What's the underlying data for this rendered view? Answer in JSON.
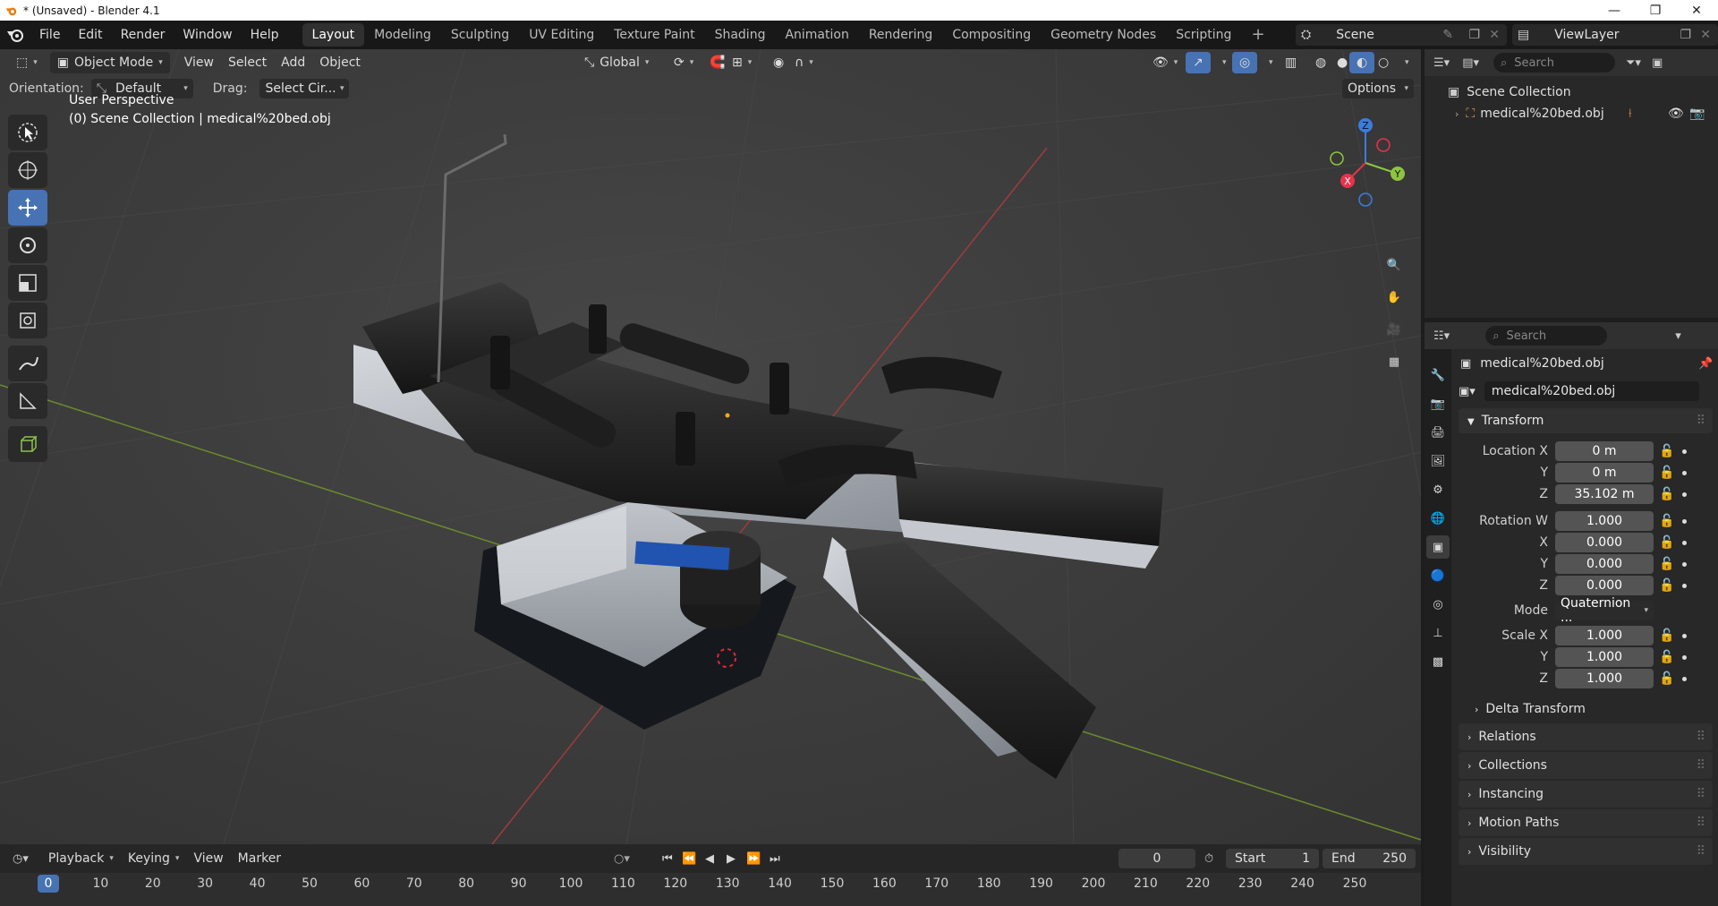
{
  "window": {
    "title": "* (Unsaved) - Blender 4.1",
    "minimize": "—",
    "maximize": "❐",
    "close": "✕"
  },
  "menu": [
    "File",
    "Edit",
    "Render",
    "Window",
    "Help"
  ],
  "workspaces": [
    "Layout",
    "Modeling",
    "Sculpting",
    "UV Editing",
    "Texture Paint",
    "Shading",
    "Animation",
    "Rendering",
    "Compositing",
    "Geometry Nodes",
    "Scripting"
  ],
  "active_workspace": "Layout",
  "scene": {
    "name": "Scene"
  },
  "view_layer": {
    "name": "ViewLayer"
  },
  "viewport": {
    "mode": "Object Mode",
    "menus": [
      "View",
      "Select",
      "Add",
      "Object"
    ],
    "transform_orientation": "Global",
    "orientation_label": "Orientation:",
    "orientation_value": "Default",
    "drag_label": "Drag:",
    "drag_value": "Select Cir...",
    "options_label": "Options",
    "perspective_text": "User Perspective",
    "collection_text": "(0) Scene Collection | medical%20bed.obj",
    "gizmo_axes": {
      "x": "X",
      "y": "Y",
      "z": "Z"
    },
    "colors": {
      "x": "#e8334a",
      "y": "#8cc63f",
      "z": "#3b7ddd"
    }
  },
  "outliner": {
    "search_placeholder": "Search",
    "root": "Scene Collection",
    "items": [
      {
        "name": "medical%20bed.obj"
      }
    ]
  },
  "properties": {
    "search_placeholder": "Search",
    "object_name": "medical%20bed.obj",
    "datablock_name": "medical%20bed.obj",
    "transform_title": "Transform",
    "location": {
      "label": "Location X",
      "x": "0 m",
      "y": "0 m",
      "z": "35.102 m"
    },
    "rotation": {
      "label": "Rotation W",
      "w": "1.000",
      "x": "0.000",
      "y": "0.000",
      "z": "0.000"
    },
    "mode_label": "Mode",
    "mode_value": "Quaternion ...",
    "scale": {
      "label": "Scale X",
      "x": "1.000",
      "y": "1.000",
      "z": "1.000"
    },
    "axis_labels": {
      "x": "X",
      "y": "Y",
      "z": "Z"
    },
    "delta_transform": "Delta Transform",
    "panels": [
      "Relations",
      "Collections",
      "Instancing",
      "Motion Paths",
      "Visibility"
    ]
  },
  "timeline": {
    "menus": [
      "Playback",
      "Keying",
      "View",
      "Marker"
    ],
    "current_frame": "0",
    "start_label": "Start",
    "start_value": "1",
    "end_label": "End",
    "end_value": "250",
    "ruler_ticks": [
      "0",
      "10",
      "20",
      "30",
      "40",
      "50",
      "60",
      "70",
      "80",
      "90",
      "100",
      "110",
      "120",
      "130",
      "140",
      "150",
      "160",
      "170",
      "180",
      "190",
      "200",
      "210",
      "220",
      "230",
      "240",
      "250"
    ]
  }
}
